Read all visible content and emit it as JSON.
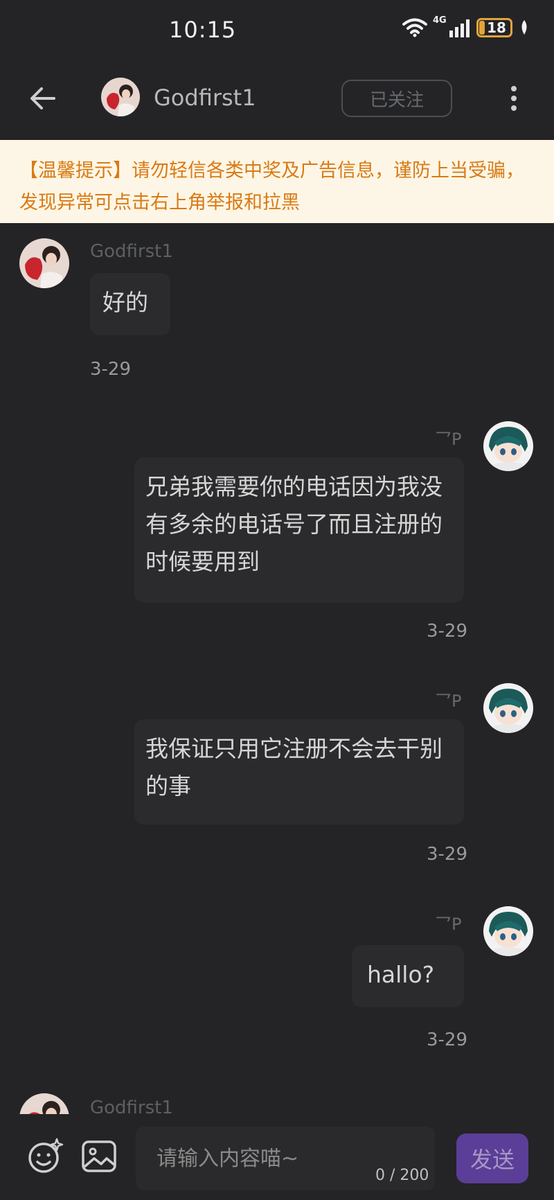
{
  "status_bar": {
    "time": "10:15",
    "network": "4G",
    "battery": "18"
  },
  "header": {
    "contact_name": "Godfirst1",
    "follow_label": "已关注"
  },
  "notice": {
    "text": "【温馨提示】请勿轻信各类中奖及广告信息，谨防上当受骗，发现异常可点击右上角举报和拉黑"
  },
  "messages": [
    {
      "side": "left",
      "sender": "Godfirst1",
      "text": "好的",
      "time": "3-29"
    },
    {
      "side": "right",
      "sender": "乛P",
      "text": "兄弟我需要你的电话因为我没有多余的电话号了而且注册的时候要用到",
      "time": "3-29"
    },
    {
      "side": "right",
      "sender": "乛P",
      "text": "我保证只用它注册不会去干别的事",
      "time": "3-29"
    },
    {
      "side": "right",
      "sender": "乛P",
      "text": "hallo?",
      "time": "3-29"
    },
    {
      "side": "left",
      "sender": "Godfirst1",
      "text": "",
      "time": ""
    }
  ],
  "input": {
    "placeholder": "请输入内容喵~",
    "counter": "0 / 200",
    "send_label": "发送"
  },
  "colors": {
    "background": "#242426",
    "notice_bg": "#fdf6e6",
    "notice_text": "#d97a14",
    "send_button": "#5b3e97",
    "battery": "#e3a43a"
  }
}
